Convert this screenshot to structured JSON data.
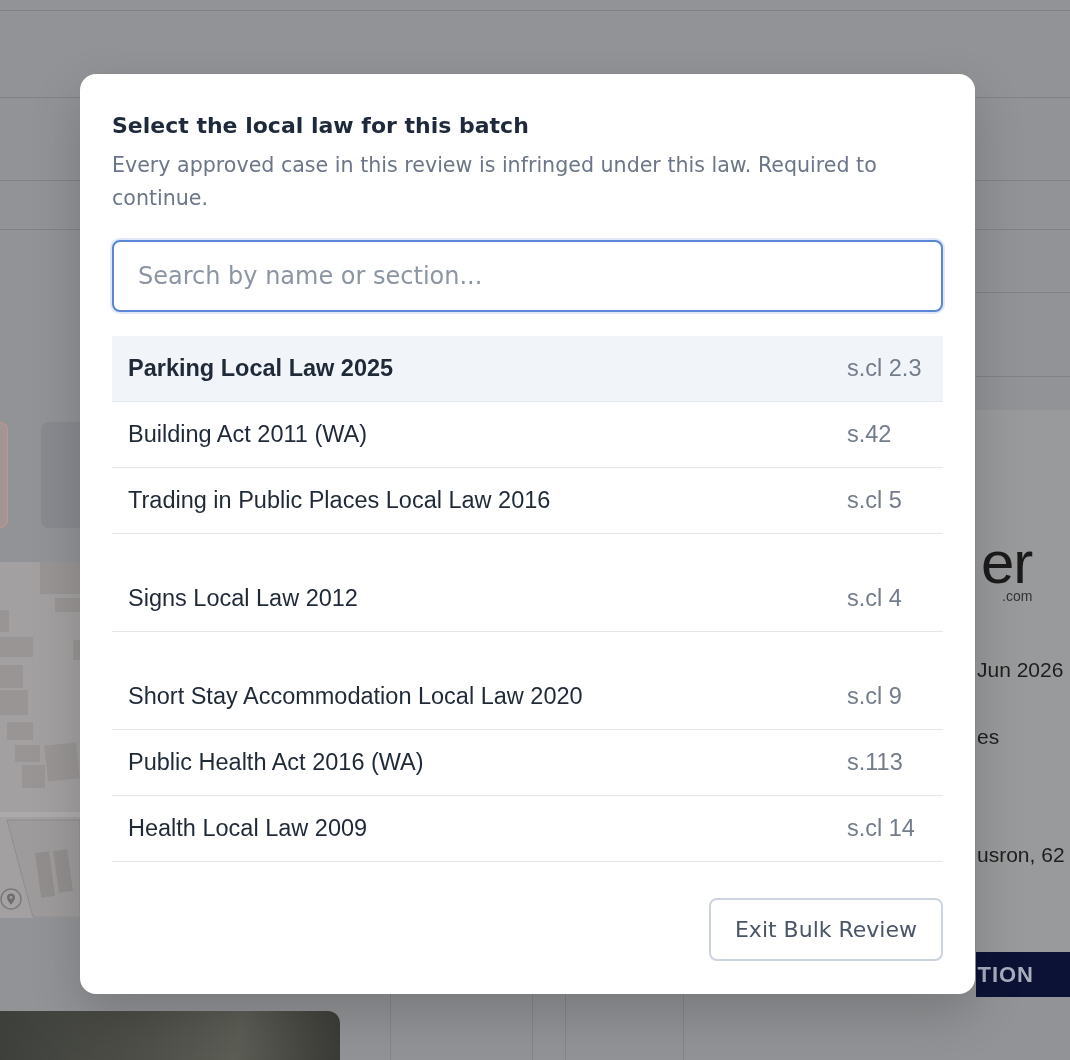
{
  "background": {
    "logo": {
      "wordmark": "er",
      "suffix": ".com"
    },
    "details": [
      "Jun 2026",
      "es",
      "usron, 62"
    ],
    "action_button": "TION"
  },
  "dialog": {
    "title": "Select the local law for this batch",
    "description": "Every approved case in this review is infringed under this law. Required to continue.",
    "search": {
      "placeholder": "Search by name or section..."
    },
    "law_groups": [
      {
        "laws": [
          {
            "name": "Parking Local Law 2025",
            "section": "s.cl 2.3",
            "selected": true
          },
          {
            "name": "Building Act 2011 (WA)",
            "section": "s.42",
            "selected": false
          },
          {
            "name": "Trading in Public Places Local Law 2016",
            "section": "s.cl 5",
            "selected": false
          }
        ]
      },
      {
        "laws": [
          {
            "name": "Signs Local Law 2012",
            "section": "s.cl 4",
            "selected": false
          }
        ]
      },
      {
        "laws": [
          {
            "name": "Short Stay Accommodation Local Law 2020",
            "section": "s.cl 9",
            "selected": false
          },
          {
            "name": "Public Health Act 2016 (WA)",
            "section": "s.113",
            "selected": false
          },
          {
            "name": "Health Local Law 2009",
            "section": "s.cl 14",
            "selected": false
          }
        ]
      }
    ],
    "buttons": [
      "Exit Bulk Review"
    ]
  }
}
